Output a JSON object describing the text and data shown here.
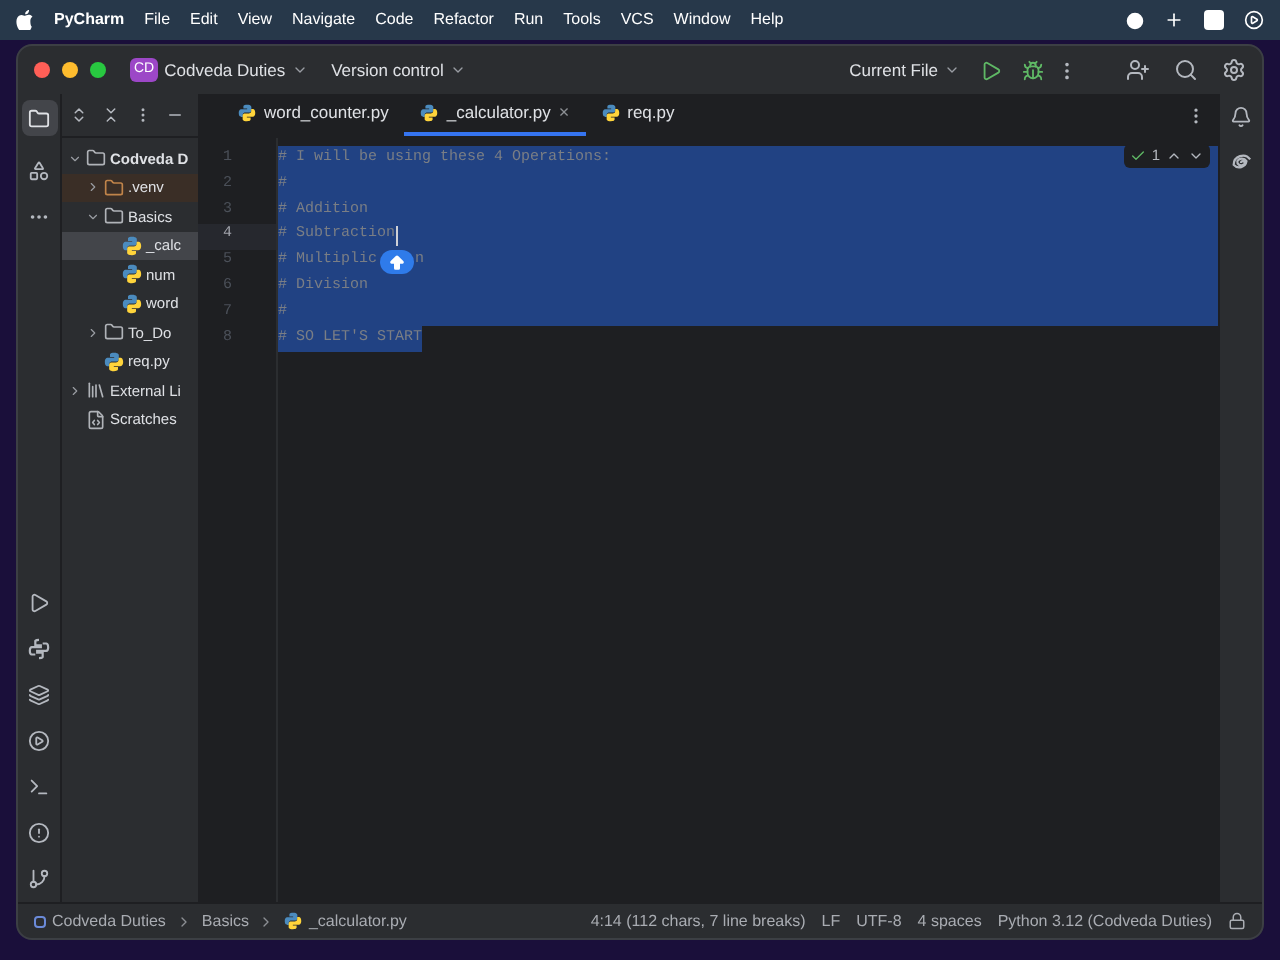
{
  "menu_bar": {
    "app": "PyCharm",
    "items": [
      "File",
      "Edit",
      "View",
      "Navigate",
      "Code",
      "Refactor",
      "Run",
      "Tools",
      "VCS",
      "Window",
      "Help"
    ]
  },
  "title_bar": {
    "project_badge": "CD",
    "project": "Codveda Duties",
    "vcs": "Version control",
    "run_config": "Current File"
  },
  "tabs": [
    {
      "label": "word_counter.py",
      "selected": false
    },
    {
      "label": "_calculator.py",
      "selected": true,
      "close": "×"
    },
    {
      "label": "req.py",
      "selected": false
    }
  ],
  "project_tree": [
    {
      "label": "Codveda D",
      "kind": "folder",
      "expanded": true,
      "selected": false,
      "children": [
        {
          "label": ".venv",
          "kind": "excluded",
          "expanded": false,
          "selected": false
        },
        {
          "label": "Basics",
          "kind": "folder",
          "expanded": true,
          "selected": false,
          "children": [
            {
              "label": "_calc",
              "kind": "python",
              "selected": true
            },
            {
              "label": "num",
              "kind": "python",
              "selected": false
            },
            {
              "label": "word",
              "kind": "python",
              "selected": false
            }
          ]
        },
        {
          "label": "To_Do",
          "kind": "folder",
          "expanded": false,
          "selected": false
        },
        {
          "label": "req.py",
          "kind": "python",
          "selected": false
        }
      ]
    },
    {
      "label": "External Li",
      "kind": "library",
      "expanded": false,
      "selected": false
    },
    {
      "label": "Scratches",
      "kind": "scratches",
      "selected": false
    }
  ],
  "editor": {
    "inspections": "1",
    "lines": [
      {
        "number": "1",
        "text": "# I will be using these 4 Operations:",
        "selected": true,
        "whole_line": true,
        "current": false
      },
      {
        "number": "2",
        "text": "#",
        "selected": true,
        "whole_line": true,
        "current": false
      },
      {
        "number": "3",
        "text": "# Addition",
        "selected": true,
        "whole_line": true,
        "current": false
      },
      {
        "number": "4",
        "text": "# Subtraction",
        "selected": true,
        "whole_line": true,
        "current": true
      },
      {
        "number": "5",
        "text": "# Multiplic",
        "text_after": "n",
        "selected": true,
        "whole_line": true,
        "current": false
      },
      {
        "number": "6",
        "text": "# Division",
        "selected": true,
        "whole_line": true,
        "current": false
      },
      {
        "number": "7",
        "text": "#",
        "selected": true,
        "whole_line": true,
        "current": false
      },
      {
        "number": "8",
        "text": "# SO LET'S START",
        "selected": true,
        "whole_line": false,
        "current": false
      }
    ]
  },
  "status_bar": {
    "breadcrumbs": [
      "Codveda Duties",
      "Basics",
      "_calculator.py"
    ],
    "position": "4:14 (112 chars, 7 line breaks)",
    "line_separator": "LF",
    "encoding": "UTF-8",
    "indent": "4 spaces",
    "interpreter": "Python 3.12 (Codveda Duties)"
  }
}
